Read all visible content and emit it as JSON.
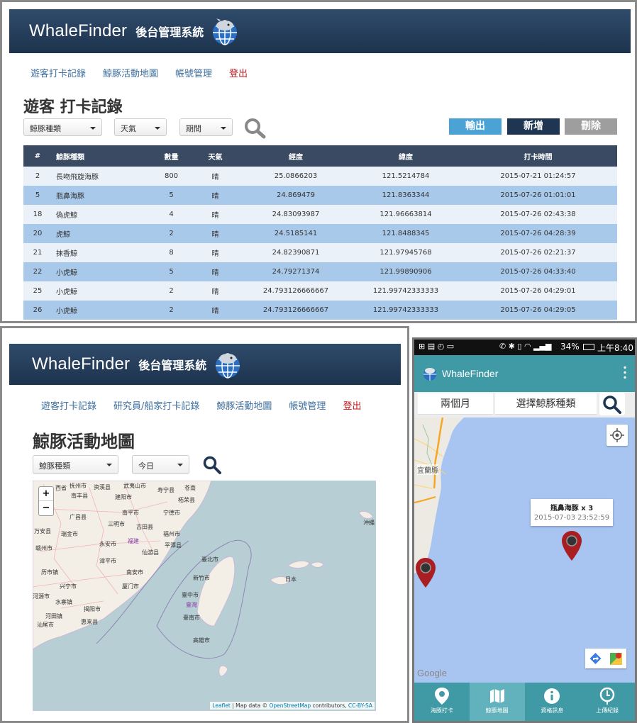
{
  "top_panel": {
    "header": {
      "brand": "WhaleFinder",
      "subtitle": "後台管理系統",
      "logo": "whale-globe-logo"
    },
    "nav": [
      {
        "label": "遊客打卡記錄"
      },
      {
        "label": "鯨豚活動地圖"
      },
      {
        "label": "帳號管理"
      },
      {
        "label": "登出"
      }
    ],
    "title": "遊客 打卡記錄",
    "filters": {
      "species": "鯨豚種類",
      "weather": "天氣",
      "period": "期間"
    },
    "search_icon": "search-icon",
    "buttons": {
      "export": "輸出",
      "add": "新增",
      "delete": "刪除"
    },
    "colors": {
      "export": "#4ba3d5",
      "add": "#1f3652",
      "delete": "#9e9e9e",
      "row_highlight": "#a9c9ea"
    },
    "table": {
      "headers": [
        "#",
        "鯨豚種類",
        "數量",
        "天氣",
        "經度",
        "緯度",
        "打卡時間"
      ],
      "rows": [
        [
          "2",
          "長吻飛旋海豚",
          "800",
          "晴",
          "25.0866203",
          "121.5214784",
          "2015-07-21 01:24:57"
        ],
        [
          "5",
          "瓶鼻海豚",
          "5",
          "晴",
          "24.869479",
          "121.8363344",
          "2015-07-26 01:01:01"
        ],
        [
          "18",
          "偽虎鯨",
          "4",
          "晴",
          "24.83093987",
          "121.96663814",
          "2015-07-26 02:43:38"
        ],
        [
          "20",
          "虎鯨",
          "2",
          "晴",
          "24.5185141",
          "121.8488345",
          "2015-07-26 04:28:39"
        ],
        [
          "21",
          "抹香鯨",
          "8",
          "晴",
          "24.82390871",
          "121.97945768",
          "2015-07-26 02:21:37"
        ],
        [
          "22",
          "小虎鯨",
          "5",
          "晴",
          "24.79271374",
          "121.99890906",
          "2015-07-26 04:33:40"
        ],
        [
          "25",
          "小虎鯨",
          "2",
          "晴",
          "24.793126666667",
          "121.99742333333",
          "2015-07-26 04:29:01"
        ],
        [
          "26",
          "小虎鯨",
          "2",
          "晴",
          "24.793126666667",
          "121.99742333333",
          "2015-07-26 04:29:05"
        ]
      ]
    }
  },
  "left_panel": {
    "header": {
      "brand": "WhaleFinder",
      "subtitle": "後台管理系統"
    },
    "nav": [
      {
        "label": "遊客打卡記錄"
      },
      {
        "label": "研究員/船家打卡記錄"
      },
      {
        "label": "鯨豚活動地圖"
      },
      {
        "label": "帳號管理"
      },
      {
        "label": "登出"
      }
    ],
    "title": "鯨豚活動地圖",
    "filters": {
      "species": "鯨豚種類",
      "date": "今日"
    },
    "map": {
      "zoom_in": "+",
      "zoom_out": "−",
      "labels": [
        "西省",
        "抚州市",
        "资溪县",
        "武夷山市",
        "寿宁县",
        "苍南",
        "南丰县",
        "建阳市",
        "柘荣县",
        "广昌县",
        "南平市",
        "宁德市",
        "三明市",
        "古田县",
        "万安县",
        "瑞金市",
        "福州市",
        "永安市",
        "福建",
        "平潭县",
        "赣州市",
        "仙游县",
        "漳平市",
        "臺北市",
        "历市镇",
        "南安市",
        "兴宁市",
        "厦门市",
        "新竹市",
        "河源市",
        "水寨镇",
        "臺中市",
        "臺灣",
        "揭阳市",
        "河田镇",
        "汕尾市",
        "惠来县",
        "臺南市",
        "高雄市",
        "日本",
        "沖縄"
      ],
      "attribution": {
        "leaflet": "Leaflet",
        "sep": " | Map data © ",
        "osm": "OpenStreetMap",
        "contrib": " contributors, ",
        "license": "CC-BY-SA"
      }
    }
  },
  "phone": {
    "status_bar": {
      "time": "上午8:40",
      "battery": "34%"
    },
    "app_bar": {
      "title": "WhaleFinder",
      "menu_icon": "overflow-menu-icon"
    },
    "filters": {
      "period": "兩個月",
      "species": "選擇鯨豚種類"
    },
    "map": {
      "google_logo": "Google",
      "city_label": "宜蘭縣",
      "info_window": {
        "title": "瓶鼻海豚 x 3",
        "time": "2015-07-03 23:52:59"
      }
    },
    "bottom_nav": [
      {
        "label": "海豚打卡",
        "icon": "pin-icon"
      },
      {
        "label": "鯨豚地圖",
        "icon": "map-icon"
      },
      {
        "label": "資格訊息",
        "icon": "info-icon"
      },
      {
        "label": "上傳紀錄",
        "icon": "clock-icon"
      }
    ]
  }
}
